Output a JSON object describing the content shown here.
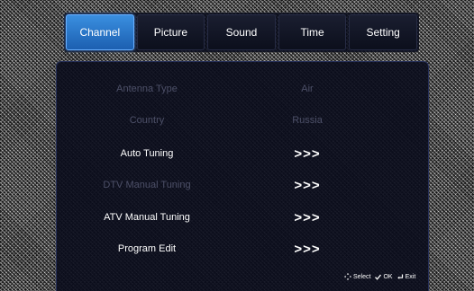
{
  "tabs": [
    {
      "label": "Channel",
      "active": true
    },
    {
      "label": "Picture",
      "active": false
    },
    {
      "label": "Sound",
      "active": false
    },
    {
      "label": "Time",
      "active": false
    },
    {
      "label": "Setting",
      "active": false
    }
  ],
  "channel_menu": {
    "antenna_type": {
      "label": "Antenna Type",
      "value": "Air"
    },
    "country": {
      "label": "Country",
      "value": "Russia"
    },
    "auto_tuning": {
      "label": "Auto Tuning",
      "action": ">>>"
    },
    "dtv_manual_tuning": {
      "label": "DTV Manual Tuning",
      "action": ">>>"
    },
    "atv_manual_tuning": {
      "label": "ATV Manual Tuning",
      "action": ">>>"
    },
    "program_edit": {
      "label": "Program Edit",
      "action": ">>>"
    }
  },
  "hints": {
    "select": "Select",
    "ok": "OK",
    "exit": "Exit"
  },
  "icons": {
    "select": "dpad-icon",
    "ok": "check-icon",
    "exit": "return-icon"
  },
  "colors": {
    "active_tab": "#2f7fd8",
    "dim_text": "#4d5068",
    "panel_bg": "#0a0c1c"
  }
}
